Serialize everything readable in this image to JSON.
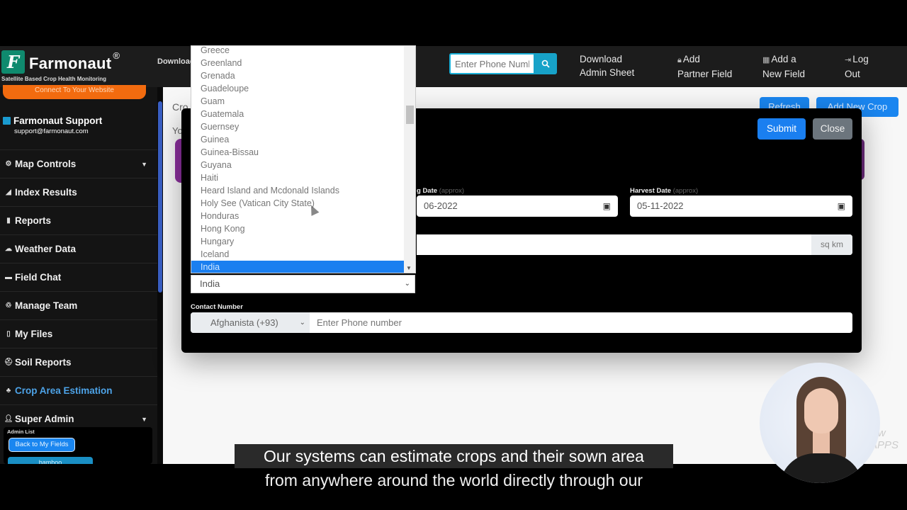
{
  "app": {
    "brand": "Farmonaut",
    "brand_mark": "®",
    "logo_letter": "F",
    "tagline": "Satellite Based Crop Health Monitoring",
    "download_results": "Download Results of"
  },
  "topnav": {
    "search_placeholder": "Enter Phone Number",
    "search_icon": "search-icon",
    "links": [
      {
        "icon": "",
        "line1": "Download",
        "line2": "Admin Sheet"
      },
      {
        "icon": "lock-icon",
        "line1": "Add",
        "line2": "Partner Field"
      },
      {
        "icon": "map-icon",
        "line1": "Add a",
        "line2": "New Field"
      },
      {
        "icon": "logout-icon",
        "line1": "Log",
        "line2": "Out"
      }
    ]
  },
  "sidebar": {
    "connect_button": "Connect To Your Website",
    "support": {
      "name": "Farmonaut Support",
      "email": "support@farmonaut.com"
    },
    "items": [
      {
        "label": "Map Controls",
        "icon": "gear-icon",
        "has_caret": true
      },
      {
        "label": "Index Results",
        "icon": "chart-icon"
      },
      {
        "label": "Reports",
        "icon": "clipboard-icon"
      },
      {
        "label": "Weather Data",
        "icon": "cloud-icon"
      },
      {
        "label": "Field Chat",
        "icon": "chat-icon"
      },
      {
        "label": "Manage Team",
        "icon": "team-icon"
      },
      {
        "label": "My Files",
        "icon": "file-icon"
      },
      {
        "label": "Soil Reports",
        "icon": "soil-icon"
      },
      {
        "label": "Crop Area Estimation",
        "icon": "crop-icon",
        "active": true
      },
      {
        "label": "Super Admin",
        "icon": "user-icon",
        "has_caret": true
      }
    ],
    "admin_list_label": "Admin List",
    "back_button": "Back to My Fields",
    "bamboo_button": "bamboo"
  },
  "main": {
    "title_partial": "Cro",
    "subtitle_partial": "Yo",
    "refresh_button": "Refresh",
    "add_new_crop_button": "Add New Crop"
  },
  "modal": {
    "submit_button": "Submit",
    "close_button": "Close",
    "sowing_date_label": "g Date",
    "sowing_date_value": "06-2022",
    "harvest_date_label": "Harvest Date",
    "approx_label": "(approx)",
    "harvest_date_value": "05-11-2022",
    "area_unit": "sq km",
    "country_selected": "India",
    "contact_label": "Contact Number",
    "country_code": "Afghanista (+93)",
    "phone_placeholder": "Enter Phone number"
  },
  "country_dropdown": {
    "options": [
      "Greece",
      "Greenland",
      "Grenada",
      "Guadeloupe",
      "Guam",
      "Guatemala",
      "Guernsey",
      "Guinea",
      "Guinea-Bissau",
      "Guyana",
      "Haiti",
      "Heard Island and Mcdonald Islands",
      "Holy See (Vatican City State)",
      "Honduras",
      "Hong Kong",
      "Hungary",
      "Iceland",
      "India"
    ],
    "selected": "India"
  },
  "captions": {
    "line1": "Our systems can estimate crops and their sown area",
    "line2": "from anywhere around the world directly through our"
  },
  "watermark": {
    "line1": "ww",
    "line2": "APPS"
  },
  "colors": {
    "primary": "#1a7ff0",
    "brand_green": "#0f8a6e",
    "connect_orange": "#f26b0f",
    "active_menu": "#4da3e8",
    "search_teal": "#17a2c8"
  }
}
